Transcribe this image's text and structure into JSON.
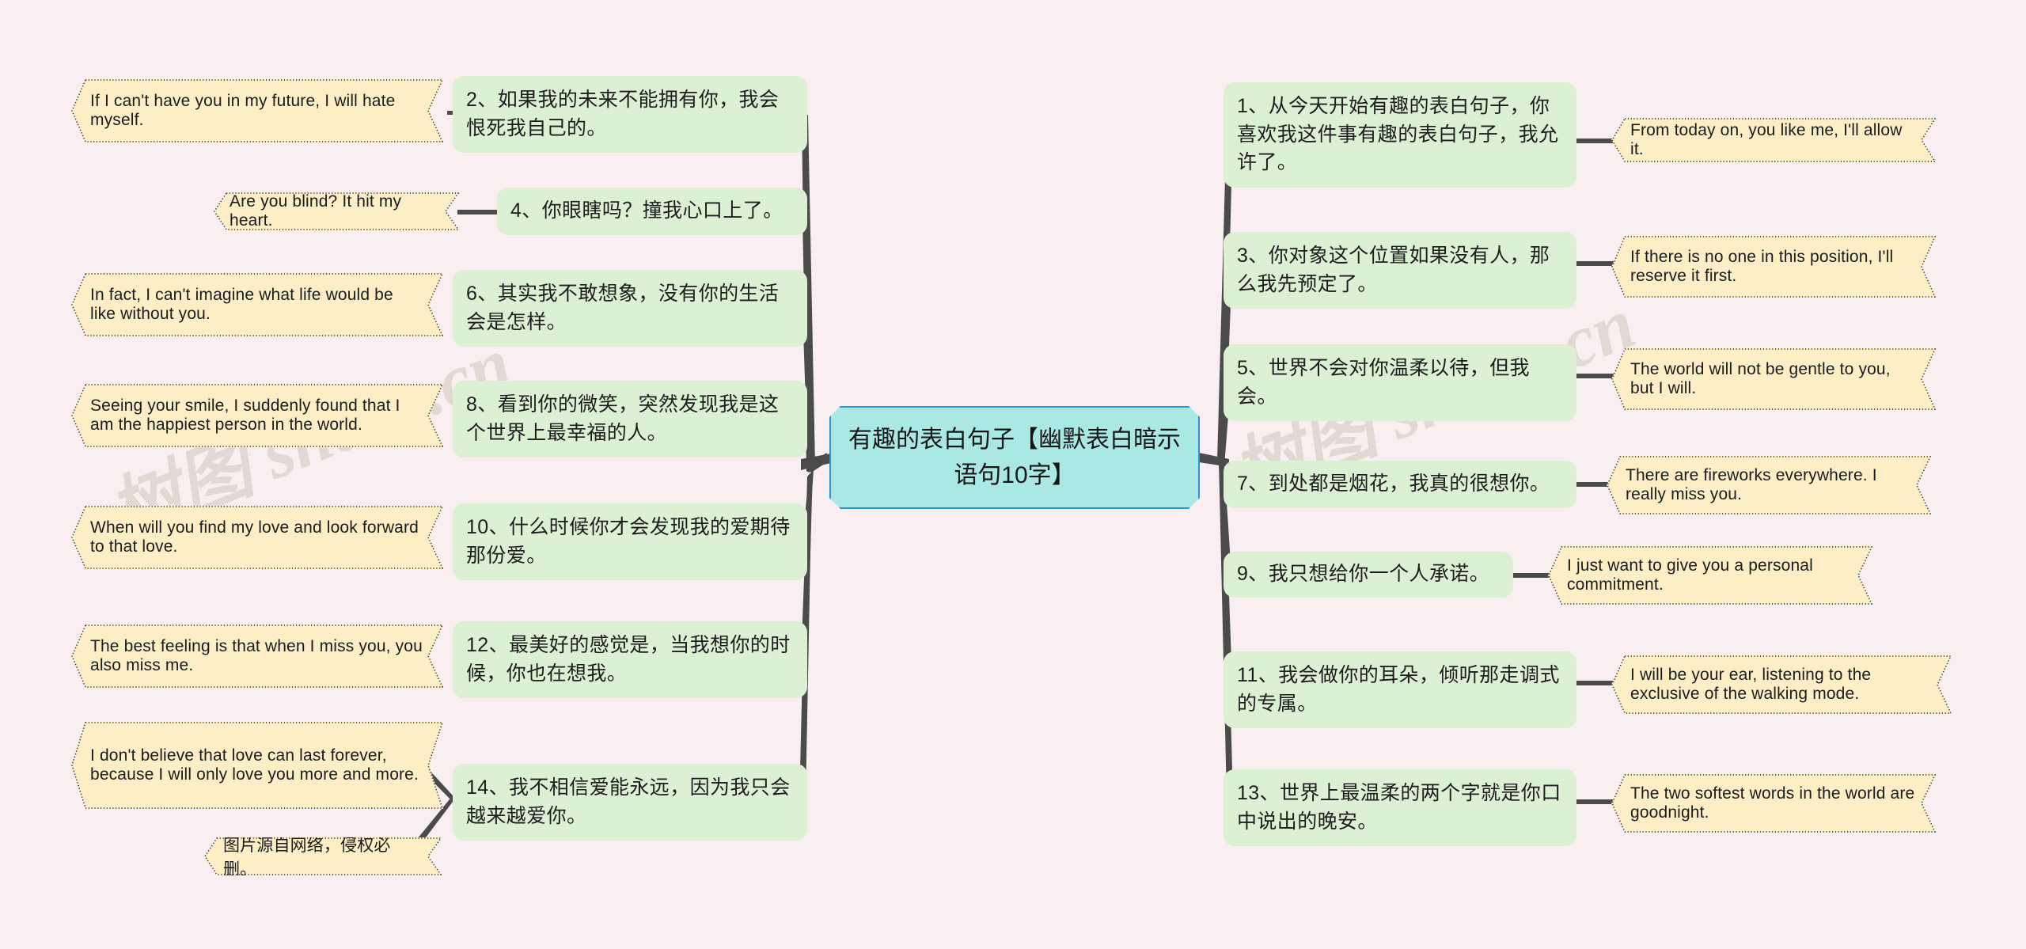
{
  "meta": {
    "title": "有趣的表白句子【幽默表白暗示语句10字】",
    "watermark": "树图 shutu.cn",
    "background_color": "#f9eff1",
    "green_color": "#dcf0d4",
    "yellow_color": "#fdeec5",
    "center_fill": "#a9e8e3",
    "center_border": "#2a93d5",
    "connector_color": "#4b4b4b"
  },
  "center": {
    "label": "有趣的表白句子【幽默表白暗示语句10字】"
  },
  "left_branches": [
    {
      "cn": "2、如果我的未来不能拥有你，我会恨死我自己的。",
      "en": "If I can't have you in my future, I will hate myself."
    },
    {
      "cn": "4、你眼瞎吗？撞我心口上了。",
      "en": "Are you blind? It hit my heart."
    },
    {
      "cn": "6、其实我不敢想象，没有你的生活会是怎样。",
      "en": "In fact, I can't imagine what life would be like without you."
    },
    {
      "cn": "8、看到你的微笑，突然发现我是这个世界上最幸福的人。",
      "en": "Seeing your smile, I suddenly found that I am the happiest person in the world."
    },
    {
      "cn": "10、什么时候你才会发现我的爱期待那份爱。",
      "en": "When will you find my love and look forward to that love."
    },
    {
      "cn": "12、最美好的感觉是，当我想你的时候，你也在想我。",
      "en": "The best feeling is that when I miss you, you also miss me."
    },
    {
      "cn": "14、我不相信爱能永远，因为我只会越来越爱你。",
      "en": "I don't believe that love can last forever, because I will only love you more and more.",
      "en2": "图片源自网络，侵权必删。"
    }
  ],
  "right_branches": [
    {
      "cn": "1、从今天开始有趣的表白句子，你喜欢我这件事有趣的表白句子，我允许了。",
      "en": "From today on, you like me, I'll allow it."
    },
    {
      "cn": "3、你对象这个位置如果没有人，那么我先预定了。",
      "en": "If there is no one in this position, I'll reserve it first."
    },
    {
      "cn": "5、世界不会对你温柔以待，但我会。",
      "en": "The world will not be gentle to you, but I will."
    },
    {
      "cn": "7、到处都是烟花，我真的很想你。",
      "en": "There are fireworks everywhere. I really miss you."
    },
    {
      "cn": "9、我只想给你一个人承诺。",
      "en": "I just want to give you a personal commitment."
    },
    {
      "cn": "11、我会做你的耳朵，倾听那走调式的专属。",
      "en": "I will be your ear, listening to the exclusive of the walking mode."
    },
    {
      "cn": "13、世界上最温柔的两个字就是你口中说出的晚安。",
      "en": "The two softest words in the world are goodnight."
    }
  ]
}
